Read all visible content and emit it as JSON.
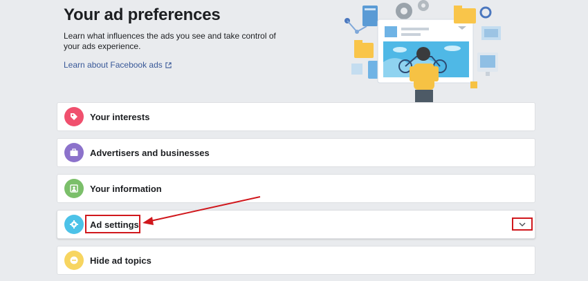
{
  "header": {
    "title": "Your ad preferences",
    "description": "Learn what influences the ads you see and take control of your ads experience.",
    "learn_link": "Learn about Facebook ads"
  },
  "sections": [
    {
      "label": "Your interests",
      "icon": "tag-icon",
      "color": "#f0506e"
    },
    {
      "label": "Advertisers and businesses",
      "icon": "briefcase-icon",
      "color": "#8c72cb"
    },
    {
      "label": "Your information",
      "icon": "profile-card-icon",
      "color": "#7bbf6a"
    },
    {
      "label": "Ad settings",
      "icon": "gear-icon",
      "color": "#4cc2e8"
    },
    {
      "label": "Hide ad topics",
      "icon": "minus-circle-icon",
      "color": "#f7d560"
    }
  ],
  "annotations": {
    "highlight_color": "#d0171c"
  }
}
